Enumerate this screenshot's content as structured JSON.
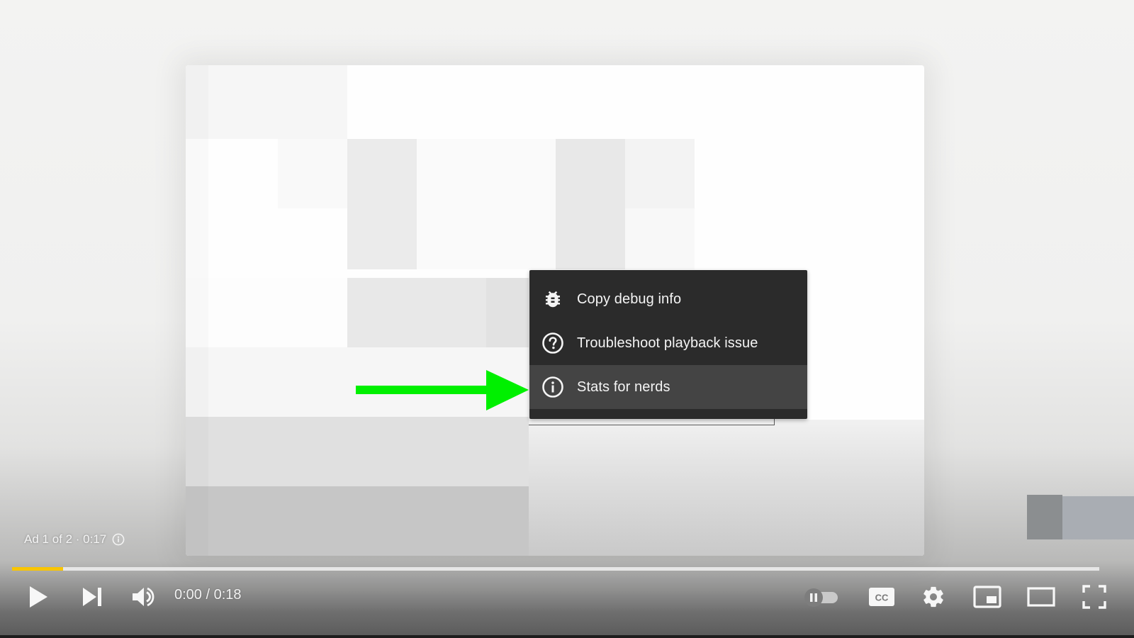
{
  "context_menu": {
    "items": [
      {
        "label": "Copy debug info",
        "icon": "bug-icon",
        "highlighted": false
      },
      {
        "label": "Troubleshoot playback issue",
        "icon": "help-circle-icon",
        "highlighted": false
      },
      {
        "label": "Stats for nerds",
        "icon": "info-circle-icon",
        "highlighted": true
      }
    ]
  },
  "annotation": {
    "arrow_color": "#00f000",
    "points_to": "Stats for nerds"
  },
  "ad": {
    "label": "Ad 1 of 2 · 0:17",
    "icon": "info-icon"
  },
  "progress": {
    "played_fraction": 0.047,
    "color": "#f9c500"
  },
  "controls": {
    "time": "0:00 / 0:18",
    "play": "play-icon",
    "next": "skip-next-icon",
    "volume": "volume-icon",
    "autoplay": "autoplay-toggle",
    "captions": "CC",
    "settings": "gear-icon",
    "miniplayer": "miniplayer-icon",
    "theater": "theater-mode-icon",
    "fullscreen": "fullscreen-icon"
  }
}
